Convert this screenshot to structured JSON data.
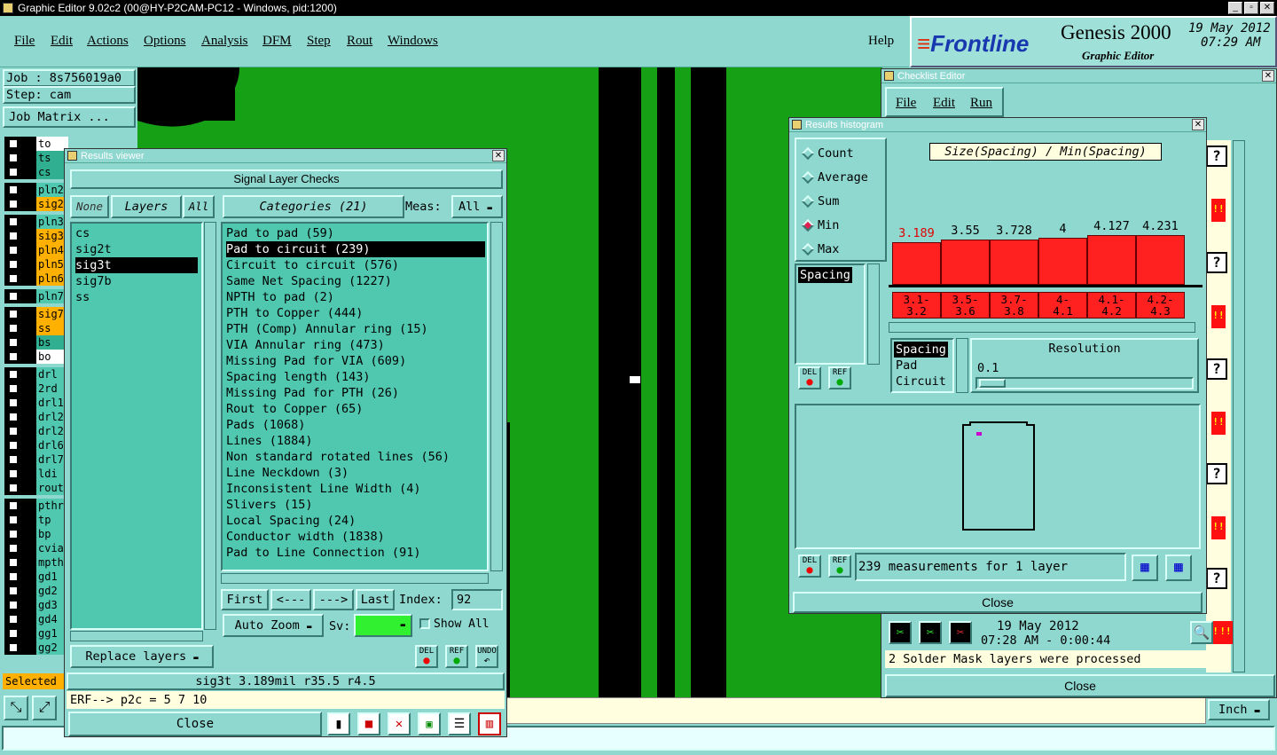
{
  "app": {
    "title": "Graphic Editor 9.02c2 (00@HY-P2CAM-PC12 - Windows, pid:1200)",
    "menu": [
      "File",
      "Edit",
      "Actions",
      "Options",
      "Analysis",
      "DFM",
      "Step",
      "Rout",
      "Windows"
    ],
    "help": "Help",
    "brand_logo": "Frontline",
    "brand_product": "Genesis 2000",
    "brand_sub": "Graphic Editor",
    "date": "19 May 2012",
    "time": "07:29 AM"
  },
  "left": {
    "job": "Job : 8s756019a0",
    "step": "Step: cam",
    "job_matrix": "Job Matrix ...",
    "layers": [
      {
        "name": "to",
        "color": "#ffffff"
      },
      {
        "name": "ts",
        "color": "#30b090"
      },
      {
        "name": "cs",
        "color": "#30b090"
      },
      {
        "name": "pln2",
        "color": "#50c8b0"
      },
      {
        "name": "sig2",
        "color": "#ffb000"
      },
      {
        "name": "pln3",
        "color": "#50c8b0"
      },
      {
        "name": "sig3",
        "color": "#ffb000"
      },
      {
        "name": "pln4",
        "color": "#ffb000"
      },
      {
        "name": "pln5",
        "color": "#ffb000"
      },
      {
        "name": "pln6",
        "color": "#ffb000"
      },
      {
        "name": "pln7",
        "color": "#50c8b0"
      },
      {
        "name": "sig7",
        "color": "#ffb000"
      },
      {
        "name": "ss",
        "color": "#ffb000"
      },
      {
        "name": "bs",
        "color": "#30b090"
      },
      {
        "name": "bo",
        "color": "#ffffff"
      },
      {
        "name": "drl",
        "color": "#50c8b0"
      },
      {
        "name": "2rd",
        "color": "#50c8b0"
      },
      {
        "name": "drl1",
        "color": "#50c8b0"
      },
      {
        "name": "drl2",
        "color": "#50c8b0"
      },
      {
        "name": "drl2",
        "color": "#50c8b0"
      },
      {
        "name": "drl6",
        "color": "#50c8b0"
      },
      {
        "name": "drl7",
        "color": "#50c8b0"
      },
      {
        "name": "ldi",
        "color": "#50c8b0"
      },
      {
        "name": "rout",
        "color": "#50c8b0"
      },
      {
        "name": "pthr",
        "color": "#50c8b0"
      },
      {
        "name": "tp",
        "color": "#50c8b0"
      },
      {
        "name": "bp",
        "color": "#50c8b0"
      },
      {
        "name": "cvia",
        "color": "#50c8b0"
      },
      {
        "name": "mpth",
        "color": "#50c8b0"
      },
      {
        "name": "gd1",
        "color": "#50c8b0"
      },
      {
        "name": "gd2",
        "color": "#50c8b0"
      },
      {
        "name": "gd3",
        "color": "#50c8b0"
      },
      {
        "name": "gd4",
        "color": "#50c8b0"
      },
      {
        "name": "gg1",
        "color": "#50c8b0"
      },
      {
        "name": "gg2",
        "color": "#50c8b0"
      }
    ],
    "selected": "Selected"
  },
  "results_viewer": {
    "title": "Results viewer",
    "header": "Signal Layer Checks",
    "none": "None",
    "layers_label": "Layers",
    "all": "All",
    "layers": [
      "cs",
      "sig2t",
      "sig3t",
      "sig7b",
      "ss"
    ],
    "selected_layer": 2,
    "categories_label": "Categories (21)",
    "meas_label": "Meas:",
    "meas_value": "All",
    "categories": [
      "Pad to pad (59)",
      "Pad to circuit (239)",
      "Circuit to circuit (576)",
      "Same Net Spacing (1227)",
      "NPTH to pad (2)",
      "PTH to Copper (444)",
      "PTH (Comp) Annular ring (15)",
      "VIA Annular ring (473)",
      "Missing Pad for VIA (609)",
      "Spacing length (143)",
      "Missing Pad for PTH (26)",
      "Rout to Copper (65)",
      "Pads (1068)",
      "Lines (1884)",
      "Non standard rotated lines (56)",
      "Line Neckdown (3)",
      "Inconsistent Line Width (4)",
      "Slivers (15)",
      "Local Spacing (24)",
      "Conductor width (1838)",
      "Pad to Line Connection (91)"
    ],
    "selected_category": 1,
    "first": "First",
    "prev": "<---",
    "next": "--->",
    "last": "Last",
    "index_label": "Index:",
    "index_value": "92",
    "auto_zoom": "Auto Zoom",
    "sv_label": "Sv:",
    "show_all": "Show All",
    "replace_layers": "Replace layers",
    "del": "DEL",
    "ref": "REF",
    "undo": "UNDO",
    "status": "sig3t 3.189mil  r35.5  r4.5",
    "close": "Close"
  },
  "command_line": "ERF--> p2c = 5 7 10",
  "checklist": {
    "title": "Checklist Editor",
    "menu": [
      "File",
      "Edit",
      "Run"
    ],
    "date": "19 May 2012",
    "time": "07:28 AM - 0:00:44",
    "message": "2 Solder Mask layers were processed",
    "close": "Close",
    "units": "Inch"
  },
  "histogram": {
    "title": "Results histogram",
    "modes": [
      "Count",
      "Average",
      "Sum",
      "Min",
      "Max"
    ],
    "selected_mode": 3,
    "list_item": "Spacing",
    "chart_title": "Size(Spacing) / Min(Spacing)",
    "bars": [
      {
        "value": "3.189",
        "range": "3.1-\n3.2",
        "highlight": true,
        "fill": 0.72
      },
      {
        "value": "3.55",
        "range": "3.5-\n3.6",
        "highlight": false,
        "fill": 0.78
      },
      {
        "value": "3.728",
        "range": "3.7-\n3.8",
        "highlight": false,
        "fill": 0.78
      },
      {
        "value": "4",
        "range": "4-\n4.1",
        "highlight": false,
        "fill": 0.8
      },
      {
        "value": "4.127",
        "range": "4.1-\n4.2",
        "highlight": false,
        "fill": 0.85
      },
      {
        "value": "4.231",
        "range": "4.2-\n4.3",
        "highlight": false,
        "fill": 0.85
      }
    ],
    "types": [
      "Spacing",
      "Pad",
      "Circuit"
    ],
    "resolution_label": "Resolution",
    "resolution_value": "0.1",
    "del": "DEL",
    "ref": "REF",
    "measurements": "239 measurements for 1 layer",
    "close": "Close"
  }
}
